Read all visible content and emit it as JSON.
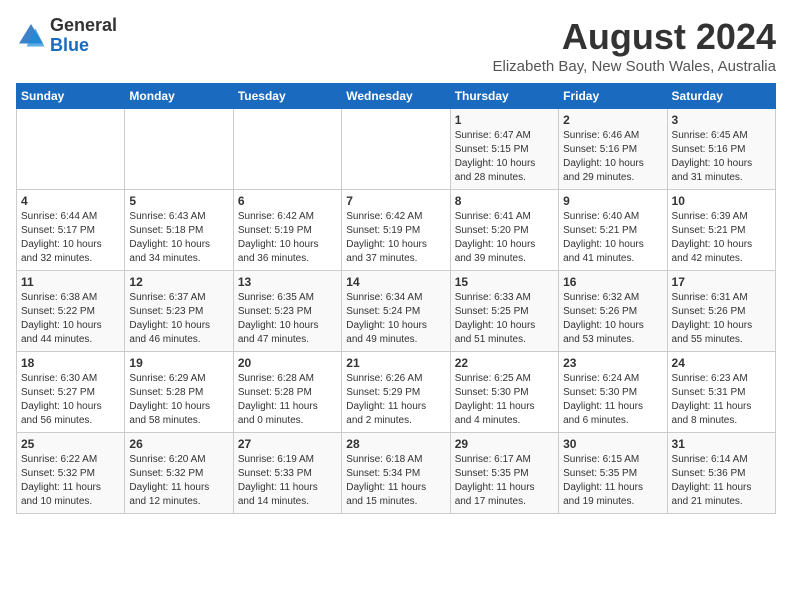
{
  "header": {
    "logo_general": "General",
    "logo_blue": "Blue",
    "month_title": "August 2024",
    "subtitle": "Elizabeth Bay, New South Wales, Australia"
  },
  "weekdays": [
    "Sunday",
    "Monday",
    "Tuesday",
    "Wednesday",
    "Thursday",
    "Friday",
    "Saturday"
  ],
  "weeks": [
    [
      {
        "day": "",
        "info": ""
      },
      {
        "day": "",
        "info": ""
      },
      {
        "day": "",
        "info": ""
      },
      {
        "day": "",
        "info": ""
      },
      {
        "day": "1",
        "info": "Sunrise: 6:47 AM\nSunset: 5:15 PM\nDaylight: 10 hours\nand 28 minutes."
      },
      {
        "day": "2",
        "info": "Sunrise: 6:46 AM\nSunset: 5:16 PM\nDaylight: 10 hours\nand 29 minutes."
      },
      {
        "day": "3",
        "info": "Sunrise: 6:45 AM\nSunset: 5:16 PM\nDaylight: 10 hours\nand 31 minutes."
      }
    ],
    [
      {
        "day": "4",
        "info": "Sunrise: 6:44 AM\nSunset: 5:17 PM\nDaylight: 10 hours\nand 32 minutes."
      },
      {
        "day": "5",
        "info": "Sunrise: 6:43 AM\nSunset: 5:18 PM\nDaylight: 10 hours\nand 34 minutes."
      },
      {
        "day": "6",
        "info": "Sunrise: 6:42 AM\nSunset: 5:19 PM\nDaylight: 10 hours\nand 36 minutes."
      },
      {
        "day": "7",
        "info": "Sunrise: 6:42 AM\nSunset: 5:19 PM\nDaylight: 10 hours\nand 37 minutes."
      },
      {
        "day": "8",
        "info": "Sunrise: 6:41 AM\nSunset: 5:20 PM\nDaylight: 10 hours\nand 39 minutes."
      },
      {
        "day": "9",
        "info": "Sunrise: 6:40 AM\nSunset: 5:21 PM\nDaylight: 10 hours\nand 41 minutes."
      },
      {
        "day": "10",
        "info": "Sunrise: 6:39 AM\nSunset: 5:21 PM\nDaylight: 10 hours\nand 42 minutes."
      }
    ],
    [
      {
        "day": "11",
        "info": "Sunrise: 6:38 AM\nSunset: 5:22 PM\nDaylight: 10 hours\nand 44 minutes."
      },
      {
        "day": "12",
        "info": "Sunrise: 6:37 AM\nSunset: 5:23 PM\nDaylight: 10 hours\nand 46 minutes."
      },
      {
        "day": "13",
        "info": "Sunrise: 6:35 AM\nSunset: 5:23 PM\nDaylight: 10 hours\nand 47 minutes."
      },
      {
        "day": "14",
        "info": "Sunrise: 6:34 AM\nSunset: 5:24 PM\nDaylight: 10 hours\nand 49 minutes."
      },
      {
        "day": "15",
        "info": "Sunrise: 6:33 AM\nSunset: 5:25 PM\nDaylight: 10 hours\nand 51 minutes."
      },
      {
        "day": "16",
        "info": "Sunrise: 6:32 AM\nSunset: 5:26 PM\nDaylight: 10 hours\nand 53 minutes."
      },
      {
        "day": "17",
        "info": "Sunrise: 6:31 AM\nSunset: 5:26 PM\nDaylight: 10 hours\nand 55 minutes."
      }
    ],
    [
      {
        "day": "18",
        "info": "Sunrise: 6:30 AM\nSunset: 5:27 PM\nDaylight: 10 hours\nand 56 minutes."
      },
      {
        "day": "19",
        "info": "Sunrise: 6:29 AM\nSunset: 5:28 PM\nDaylight: 10 hours\nand 58 minutes."
      },
      {
        "day": "20",
        "info": "Sunrise: 6:28 AM\nSunset: 5:28 PM\nDaylight: 11 hours\nand 0 minutes."
      },
      {
        "day": "21",
        "info": "Sunrise: 6:26 AM\nSunset: 5:29 PM\nDaylight: 11 hours\nand 2 minutes."
      },
      {
        "day": "22",
        "info": "Sunrise: 6:25 AM\nSunset: 5:30 PM\nDaylight: 11 hours\nand 4 minutes."
      },
      {
        "day": "23",
        "info": "Sunrise: 6:24 AM\nSunset: 5:30 PM\nDaylight: 11 hours\nand 6 minutes."
      },
      {
        "day": "24",
        "info": "Sunrise: 6:23 AM\nSunset: 5:31 PM\nDaylight: 11 hours\nand 8 minutes."
      }
    ],
    [
      {
        "day": "25",
        "info": "Sunrise: 6:22 AM\nSunset: 5:32 PM\nDaylight: 11 hours\nand 10 minutes."
      },
      {
        "day": "26",
        "info": "Sunrise: 6:20 AM\nSunset: 5:32 PM\nDaylight: 11 hours\nand 12 minutes."
      },
      {
        "day": "27",
        "info": "Sunrise: 6:19 AM\nSunset: 5:33 PM\nDaylight: 11 hours\nand 14 minutes."
      },
      {
        "day": "28",
        "info": "Sunrise: 6:18 AM\nSunset: 5:34 PM\nDaylight: 11 hours\nand 15 minutes."
      },
      {
        "day": "29",
        "info": "Sunrise: 6:17 AM\nSunset: 5:35 PM\nDaylight: 11 hours\nand 17 minutes."
      },
      {
        "day": "30",
        "info": "Sunrise: 6:15 AM\nSunset: 5:35 PM\nDaylight: 11 hours\nand 19 minutes."
      },
      {
        "day": "31",
        "info": "Sunrise: 6:14 AM\nSunset: 5:36 PM\nDaylight: 11 hours\nand 21 minutes."
      }
    ]
  ]
}
